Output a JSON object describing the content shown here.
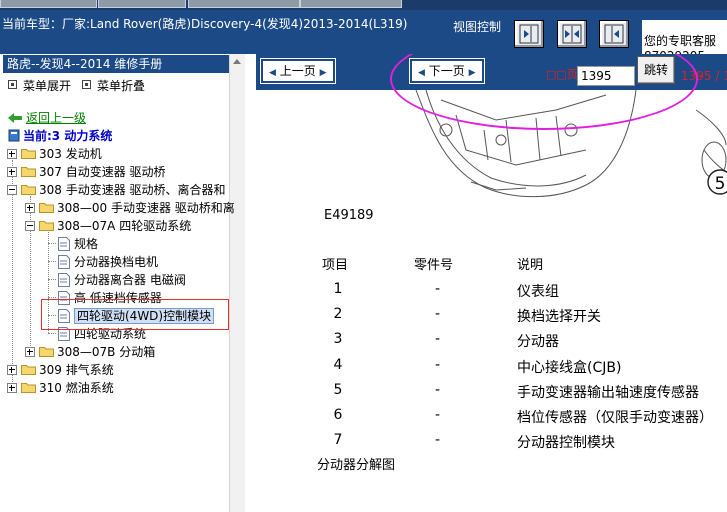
{
  "header": {
    "vehicle_line": "当前车型：厂家:Land Rover(路虎)Discovery-4(发现4)2013-2014(L319)",
    "view_control_label": "视图控制",
    "contact_line1": "您的专职客服",
    "contact_line2": "87029205"
  },
  "left": {
    "manual_title": "路虎--发现4--2014 维修手册",
    "expand_label": "菜单展开",
    "collapse_label": "菜单折叠",
    "back_label": "返回上一级",
    "current_label": "当前:3 动力系统",
    "tree": [
      {
        "id": "303",
        "label": "303 发动机",
        "expanded": false
      },
      {
        "id": "307",
        "label": "307 自动变速器 驱动桥",
        "expanded": false
      },
      {
        "id": "308",
        "label": "308 手动变速器 驱动桥、离合器和",
        "expanded": true
      },
      {
        "id": "308-00",
        "label": "308—00 手动变速器 驱动桥和离",
        "expanded": false
      },
      {
        "id": "308-07A",
        "label": "308—07A 四轮驱动系统",
        "expanded": true
      },
      {
        "id": "doc1",
        "label": "规格"
      },
      {
        "id": "doc2",
        "label": "分动器换档电机"
      },
      {
        "id": "doc3",
        "label": "分动器离合器 电磁阀"
      },
      {
        "id": "doc4",
        "label": "高 低速档传感器"
      },
      {
        "id": "doc5",
        "label": "四轮驱动(4WD)控制模块",
        "selected": true
      },
      {
        "id": "doc6",
        "label": "四轮驱动系统"
      },
      {
        "id": "308-07B",
        "label": "308—07B 分动箱",
        "expanded": false
      },
      {
        "id": "309",
        "label": "309 排气系统",
        "expanded": false
      },
      {
        "id": "310",
        "label": "310 燃油系统",
        "expanded": false
      }
    ]
  },
  "nav": {
    "prev_label": "上一页",
    "next_label": "下一页",
    "page_label": "□□页",
    "page_value": "1395",
    "jump_label": "跳转",
    "page_count": "1395 / 1"
  },
  "content": {
    "figure_code": "E49189",
    "callout": "5",
    "col_item": "项目",
    "col_part": "零件号",
    "col_desc": "说明",
    "rows": [
      {
        "item": "1",
        "part": "-",
        "desc": "仪表组"
      },
      {
        "item": "2",
        "part": "-",
        "desc": "换档选择开关"
      },
      {
        "item": "3",
        "part": "-",
        "desc": "分动器"
      },
      {
        "item": "4",
        "part": "-",
        "desc": "中心接线盒(CJB)"
      },
      {
        "item": "5",
        "part": "-",
        "desc": "手动变速器输出轴速度传感器"
      },
      {
        "item": "6",
        "part": "-",
        "desc": "档位传感器（仅限手动变速器）"
      },
      {
        "item": "7",
        "part": "-",
        "desc": "分动器控制模块"
      }
    ],
    "caption": "分动器分解图"
  },
  "colors": {
    "header_blue": "#1b4a86",
    "highlight_red": "#e03030",
    "annotation_magenta": "#e020e0",
    "link_green": "#008000",
    "current_blue": "#0000cc"
  },
  "icons": [
    "back-arrow-icon",
    "book-icon",
    "folder-icon",
    "document-icon",
    "expand-icon",
    "collapse-icon",
    "nav-right-icon",
    "nav-split-icon",
    "nav-left-icon"
  ]
}
